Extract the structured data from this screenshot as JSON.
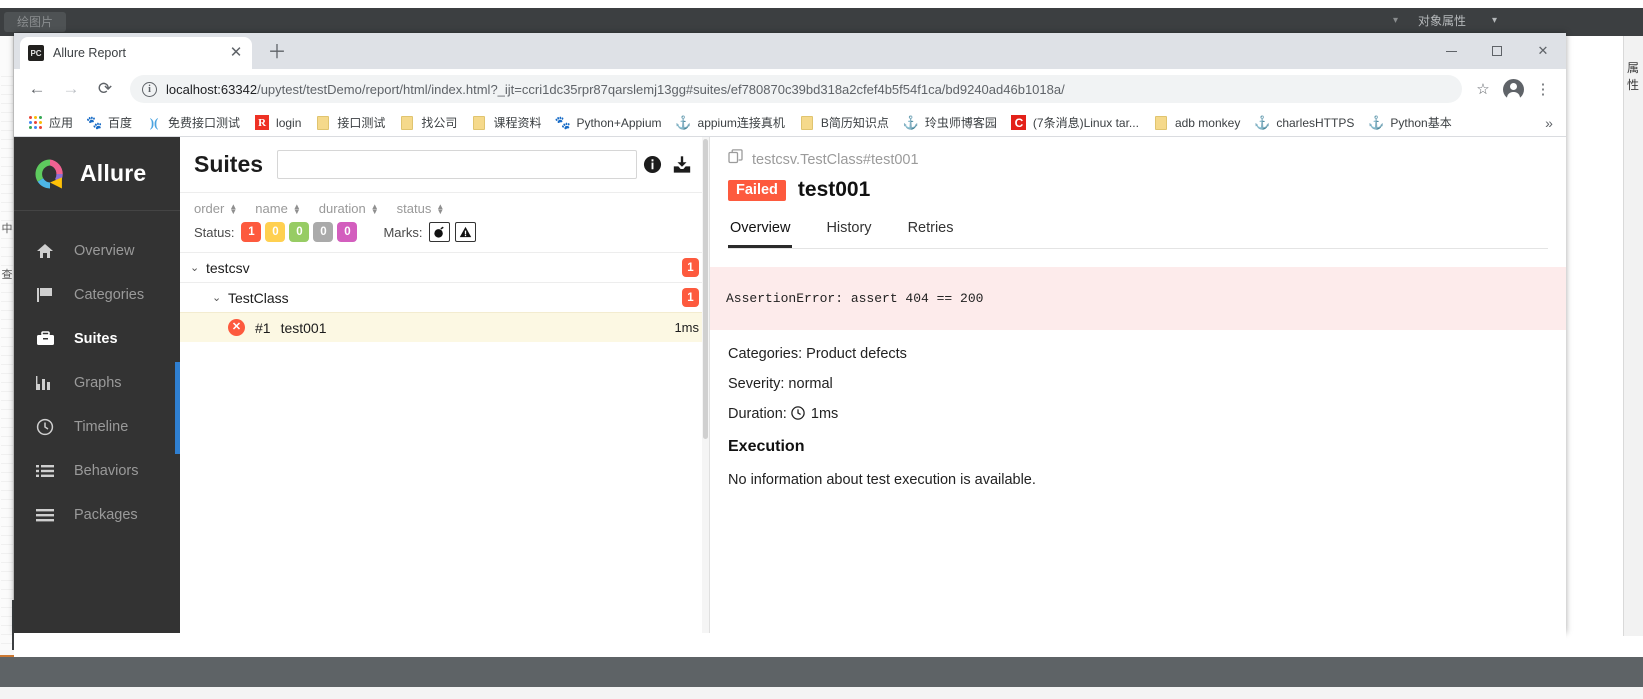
{
  "desktop": {
    "ide_tag_label": "绘图片",
    "object_props_label": "对象属性",
    "caret_glyph": "▾",
    "right_strip_text": "属性",
    "left_strip_text": "中查"
  },
  "browser": {
    "tab": {
      "favicon_label": "PC",
      "title": "Allure Report",
      "close_glyph": "✕"
    },
    "new_tab_glyph": "＋",
    "window_controls": {
      "minimize": "minimize-glyph",
      "maximize": "maximize-glyph",
      "close": "✕"
    },
    "toolbar": {
      "back_glyph": "←",
      "forward_glyph": "→",
      "reload_glyph": "⟳",
      "info_glyph": "i",
      "url_host": "localhost:63342",
      "url_path": "/upytest/testDemo/report/html/index.html?_ijt=ccri1dc35rpr87qarslemj13gg#suites/ef780870c39bd318a2cfef4b5f54f1ca/bd9240ad46b1018a/",
      "star_glyph": "☆",
      "menu_glyph": "⋮"
    },
    "bookmarks": [
      {
        "label": "应用",
        "icon": "apps-grid-icon"
      },
      {
        "label": "百度",
        "icon": "baidu-icon"
      },
      {
        "label": "免费接口测试",
        "icon": "jm-icon"
      },
      {
        "label": "login",
        "icon": "r-icon"
      },
      {
        "label": "接口测试",
        "icon": "folder-icon"
      },
      {
        "label": "找公司",
        "icon": "folder-icon"
      },
      {
        "label": "课程资料",
        "icon": "folder-icon"
      },
      {
        "label": "Python+Appium",
        "icon": "baidu-icon"
      },
      {
        "label": "appium连接真机",
        "icon": "anchor-icon"
      },
      {
        "label": "B简历知识点",
        "icon": "folder-icon"
      },
      {
        "label": "玲虫师博客园",
        "icon": "anchor-icon"
      },
      {
        "label": "(7条消息)Linux tar...",
        "icon": "c-icon"
      },
      {
        "label": "adb monkey",
        "icon": "folder-icon"
      },
      {
        "label": "charlesHTTPS",
        "icon": "anchor-icon"
      },
      {
        "label": "Python基本",
        "icon": "anchor-icon"
      }
    ],
    "bookmarks_overflow_glyph": "»"
  },
  "allure": {
    "brand": "Allure",
    "sidebar": {
      "items": [
        {
          "label": "Overview",
          "icon": "home-icon",
          "active": false
        },
        {
          "label": "Categories",
          "icon": "flag-icon",
          "active": false
        },
        {
          "label": "Suites",
          "icon": "suitcase-icon",
          "active": true
        },
        {
          "label": "Graphs",
          "icon": "bars-icon",
          "active": false
        },
        {
          "label": "Timeline",
          "icon": "clock-icon",
          "active": false
        },
        {
          "label": "Behaviors",
          "icon": "list-icon",
          "active": false
        },
        {
          "label": "Packages",
          "icon": "lines-icon",
          "active": false
        }
      ]
    },
    "tree": {
      "title": "Suites",
      "search_value": "",
      "search_placeholder": "",
      "info_icon": "info-icon",
      "download_icon": "download-icon",
      "sorts": [
        {
          "label": "order"
        },
        {
          "label": "name"
        },
        {
          "label": "duration"
        },
        {
          "label": "status"
        }
      ],
      "status_filter_label": "Status:",
      "status_chips": [
        {
          "value": "1",
          "color": "#fd5a3e"
        },
        {
          "value": "0",
          "color": "#ffd050"
        },
        {
          "value": "0",
          "color": "#97cc64"
        },
        {
          "value": "0",
          "color": "#aaaaaa"
        },
        {
          "value": "0",
          "color": "#d35ebe"
        }
      ],
      "marks_label": "Marks:",
      "marks": [
        {
          "icon": "bomb-icon",
          "glyph": "💣"
        },
        {
          "icon": "warning-icon",
          "glyph": "⚠"
        }
      ],
      "rows": [
        {
          "level": 1,
          "name": "testcsv",
          "chevron": "⌄",
          "badge": "1"
        },
        {
          "level": 2,
          "name": "TestClass",
          "chevron": "⌄",
          "badge": "1"
        }
      ],
      "leaf": {
        "status_icon": "failed-x-icon",
        "number": "#1",
        "name": "test001",
        "duration": "1ms"
      }
    },
    "detail": {
      "path_icon": "copy-icon",
      "path": "testcsv.TestClass#test001",
      "status": "Failed",
      "status_color": "#fd5a3e",
      "title": "test001",
      "tabs": [
        {
          "label": "Overview",
          "active": true
        },
        {
          "label": "History",
          "active": false
        },
        {
          "label": "Retries",
          "active": false
        }
      ],
      "error_message": "AssertionError: assert 404 == 200",
      "categories_line": "Categories: Product defects",
      "severity_line": "Severity: normal",
      "duration_label": "Duration:",
      "duration_value": "1ms",
      "execution_heading": "Execution",
      "execution_text": "No information about test execution is available."
    }
  }
}
